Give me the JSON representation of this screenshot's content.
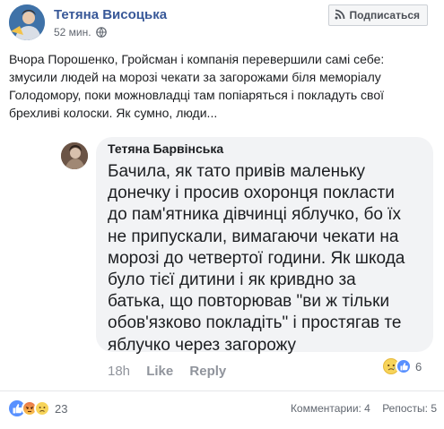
{
  "post": {
    "author": "Тетяна Висоцька",
    "time": "52 мин.",
    "follow_label": "Подписаться",
    "text_lines": [
      "Вчора Порошенко, Гройсман і компанія перевершили самі себе:",
      "змусили людей на морозі чекати за загорожами біля меморіалу",
      "Голодомору, поки можновладці там попіаряться і покладуть свої",
      "брехливі колоски. Як сумно, люди..."
    ]
  },
  "comment": {
    "author": "Тетяна Барвінська",
    "text_lines": [
      "Бачила, як тато привів маленьку",
      "донечку і просив охоронця покласти",
      "до пам'ятника дівчинці яблучко, бо їх",
      "не припускали, вимагаючи чекати на",
      "морозі до четвертої години. Як шкода",
      "було тієї дитини і як кривдно за",
      "батька, що повторював \"ви ж тільки",
      "обов'язково покладіть\" і простягав те",
      "яблучко через загорожу"
    ],
    "age": "18h",
    "like_label": "Like",
    "reply_label": "Reply",
    "reaction_count": "6"
  },
  "footer": {
    "reaction_count": "23",
    "comments_text": "Комментарии: 4",
    "reposts_text": "Репосты: 5"
  },
  "colors": {
    "link_blue": "#385898",
    "like_blue": "#5890ff",
    "bubble_gray": "#f2f3f5",
    "meta_gray": "#90949c"
  }
}
